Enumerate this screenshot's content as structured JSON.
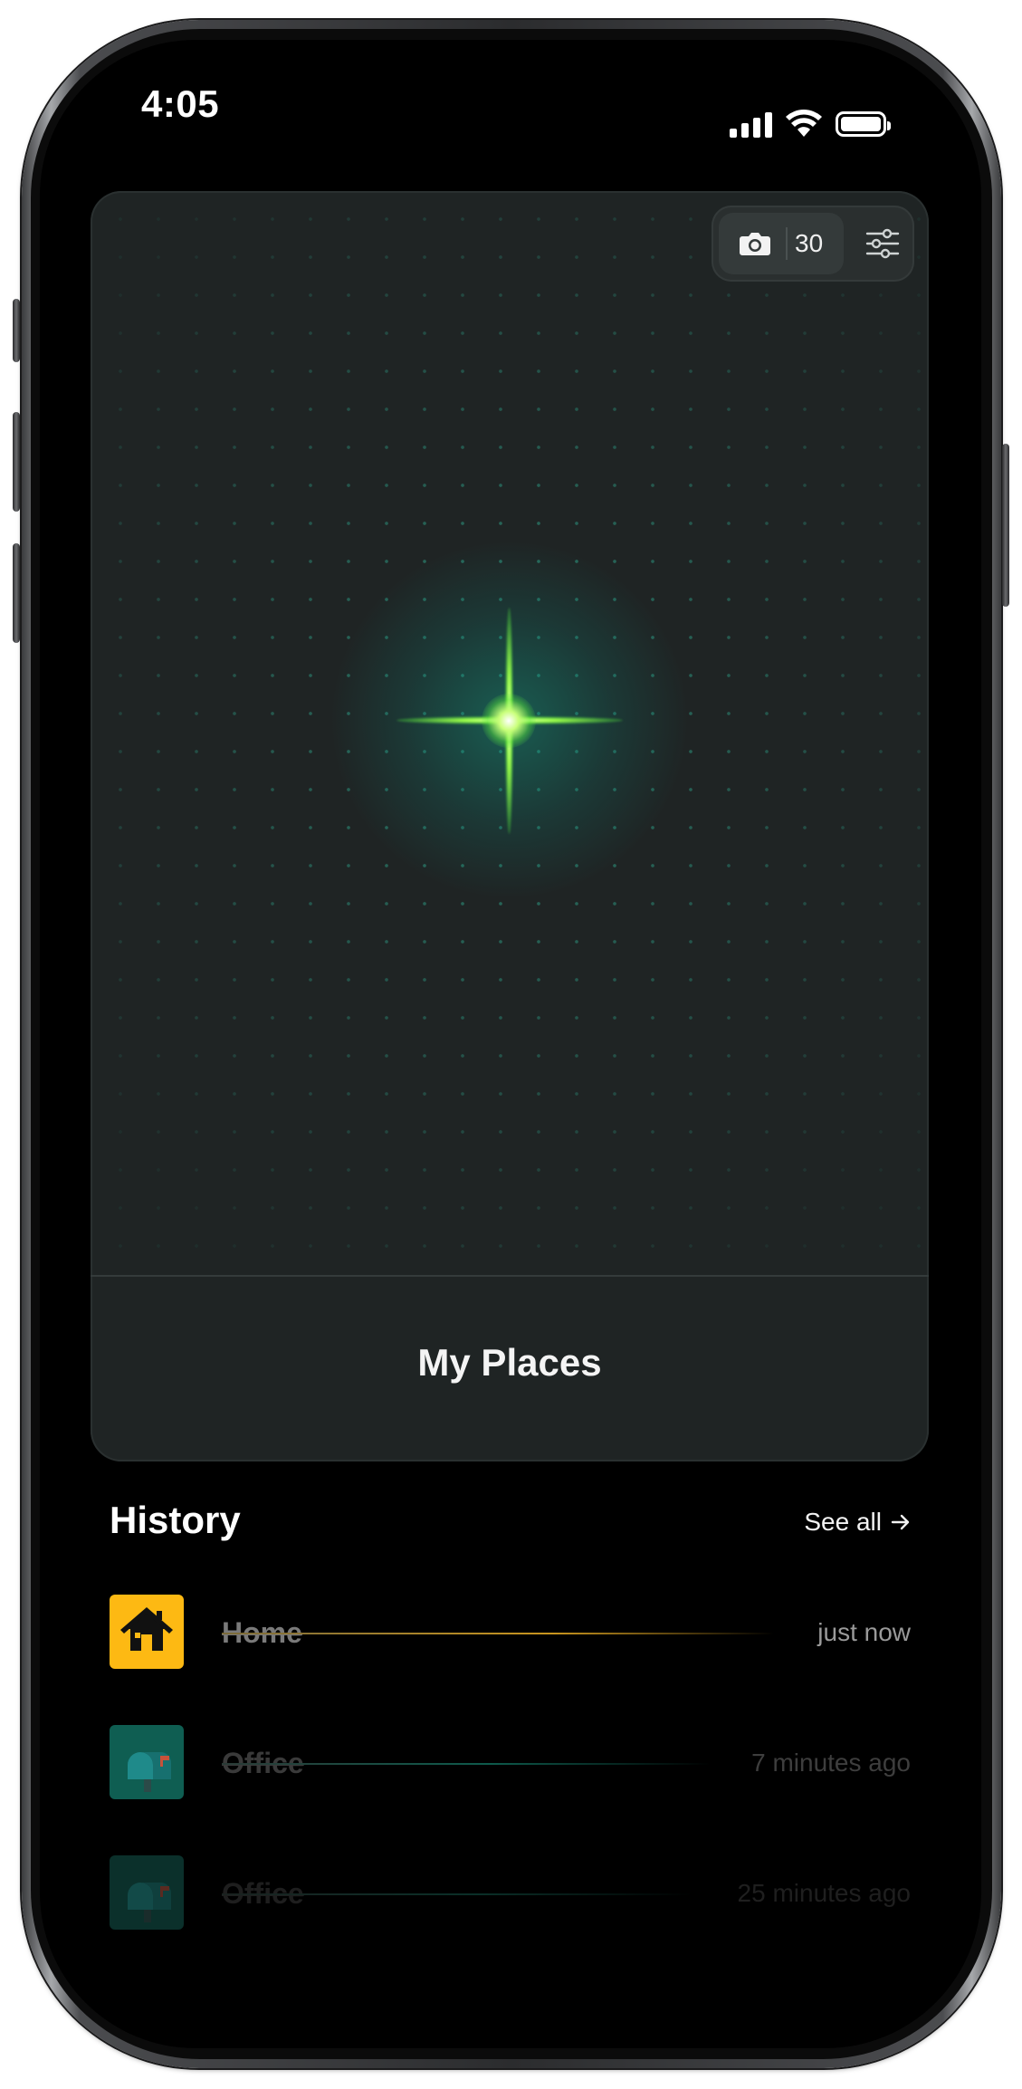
{
  "status_bar": {
    "time": "4:05"
  },
  "hero": {
    "title": "My Places",
    "camera_count": "30"
  },
  "history": {
    "title": "History",
    "see_all": "See all",
    "items": [
      {
        "name": "Home",
        "time": "just now",
        "icon": "house-icon",
        "accent": "#fdb913"
      },
      {
        "name": "Office",
        "time": "7 minutes ago",
        "icon": "mailbox-icon",
        "accent": "#0f6a5c"
      },
      {
        "name": "Office",
        "time": "25 minutes ago",
        "icon": "mailbox-icon",
        "accent": "#0f6a5c"
      }
    ]
  }
}
